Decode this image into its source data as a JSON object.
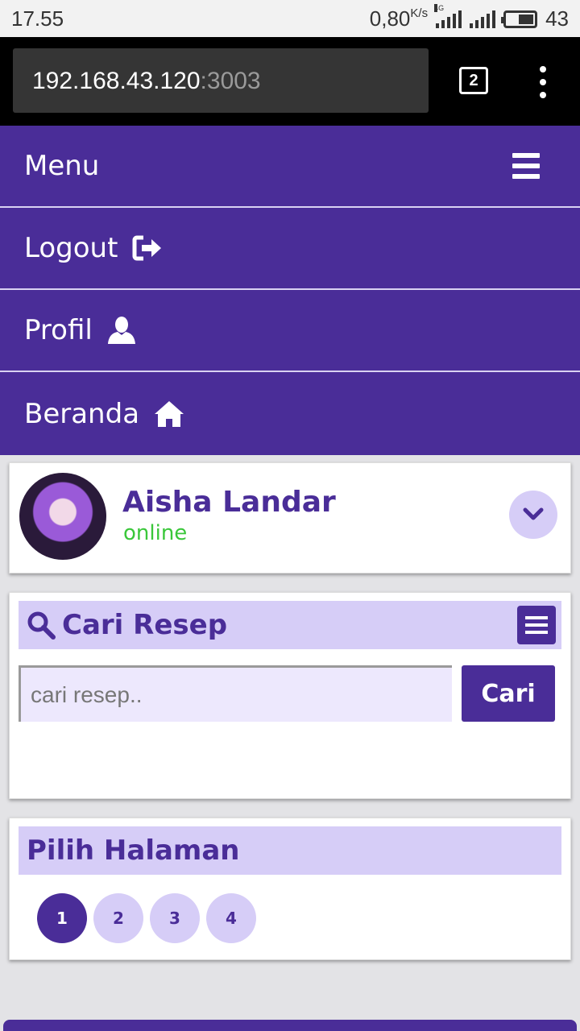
{
  "status_bar": {
    "time": "17.55",
    "speed": "0,80",
    "speed_unit": "K/s",
    "network": "4G",
    "battery": "43"
  },
  "browser": {
    "url_host": "192.168.43.120",
    "url_port": ":3003",
    "tab_count": "2"
  },
  "nav": {
    "title": "Menu",
    "items": [
      {
        "label": "Logout",
        "icon": "logout-icon"
      },
      {
        "label": "Profil",
        "icon": "user-icon"
      },
      {
        "label": "Beranda",
        "icon": "home-icon"
      }
    ]
  },
  "profile": {
    "name": "Aisha Landar",
    "status": "online"
  },
  "search": {
    "title": "Cari Resep",
    "placeholder": "cari resep..",
    "button_label": "Cari"
  },
  "pager": {
    "title": "Pilih Halaman",
    "pages": [
      "1",
      "2",
      "3",
      "4"
    ],
    "active_page": "1"
  },
  "colors": {
    "primary": "#4a2d98",
    "light": "#d6cdf7",
    "online": "#3ac73a"
  }
}
